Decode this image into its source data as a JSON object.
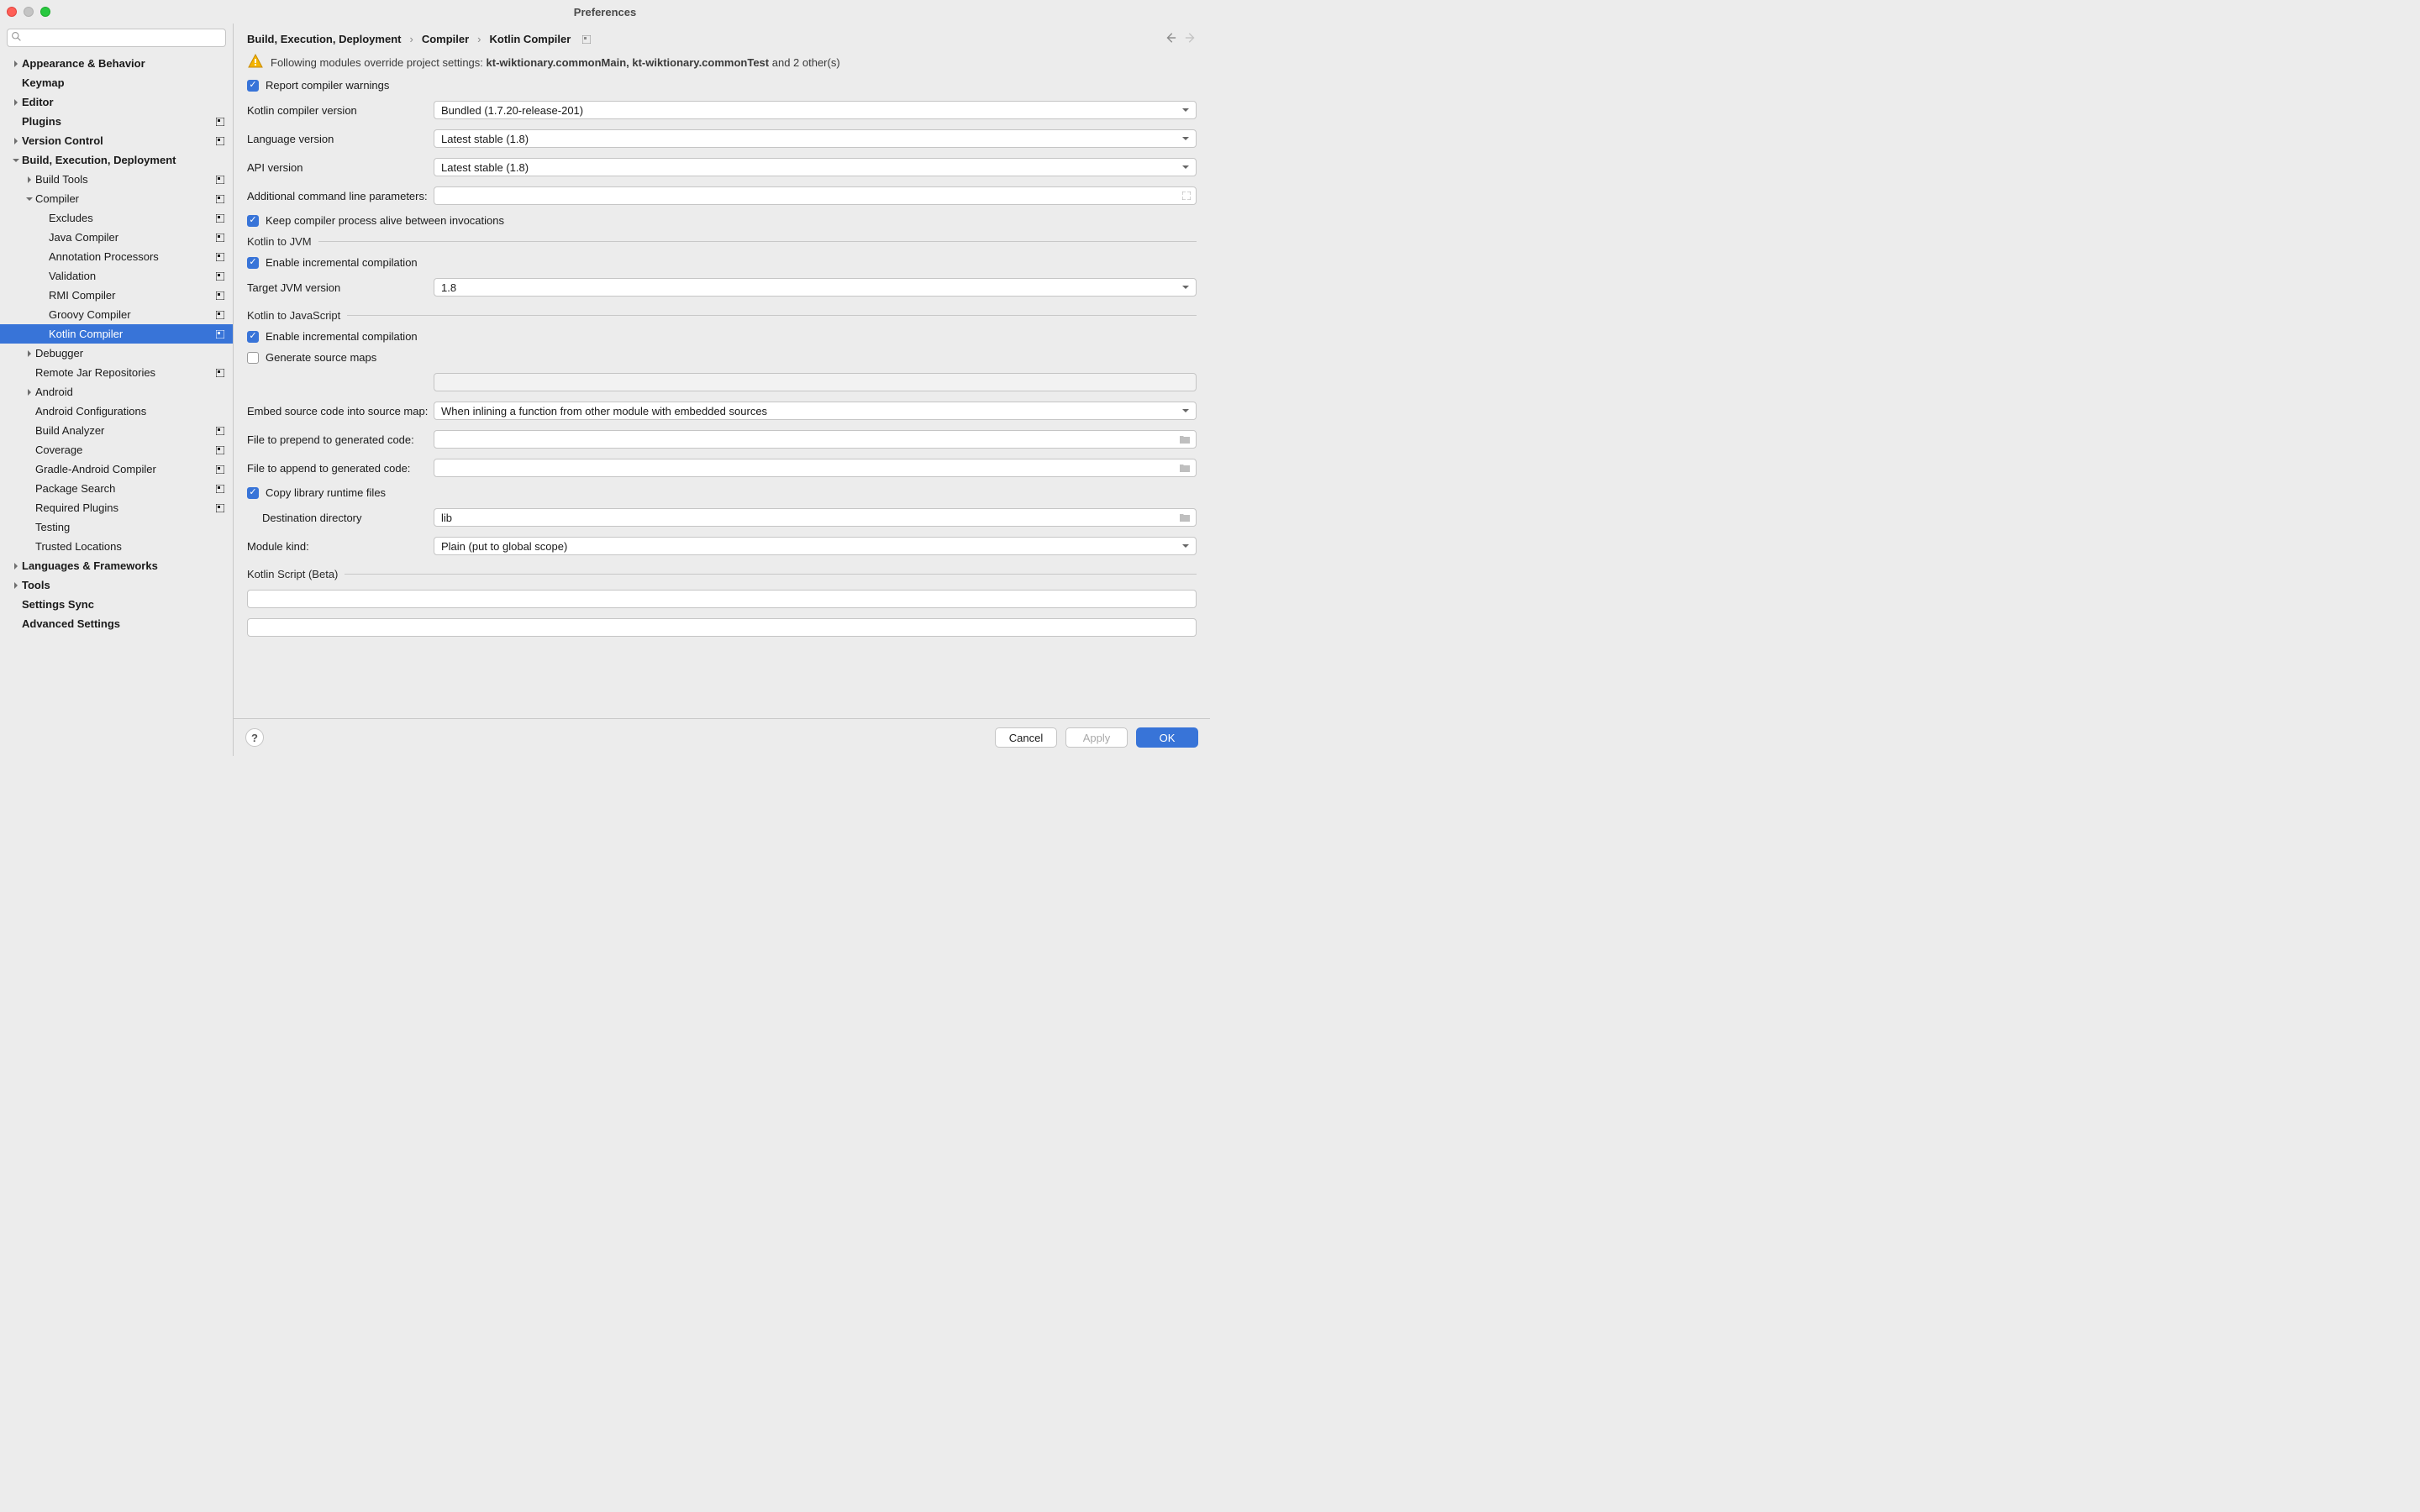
{
  "title": "Preferences",
  "search_placeholder": "",
  "sidebar": {
    "items": [
      {
        "label": "Appearance & Behavior",
        "indent": 0,
        "arrow": "right",
        "bold": true,
        "proj": false
      },
      {
        "label": "Keymap",
        "indent": 0,
        "arrow": "",
        "bold": true,
        "proj": false
      },
      {
        "label": "Editor",
        "indent": 0,
        "arrow": "right",
        "bold": true,
        "proj": false
      },
      {
        "label": "Plugins",
        "indent": 0,
        "arrow": "",
        "bold": true,
        "proj": true
      },
      {
        "label": "Version Control",
        "indent": 0,
        "arrow": "right",
        "bold": true,
        "proj": true
      },
      {
        "label": "Build, Execution, Deployment",
        "indent": 0,
        "arrow": "down",
        "bold": true,
        "proj": false
      },
      {
        "label": "Build Tools",
        "indent": 1,
        "arrow": "right",
        "bold": false,
        "proj": true
      },
      {
        "label": "Compiler",
        "indent": 1,
        "arrow": "down",
        "bold": false,
        "proj": true
      },
      {
        "label": "Excludes",
        "indent": 2,
        "arrow": "",
        "bold": false,
        "proj": true
      },
      {
        "label": "Java Compiler",
        "indent": 2,
        "arrow": "",
        "bold": false,
        "proj": true
      },
      {
        "label": "Annotation Processors",
        "indent": 2,
        "arrow": "",
        "bold": false,
        "proj": true
      },
      {
        "label": "Validation",
        "indent": 2,
        "arrow": "",
        "bold": false,
        "proj": true
      },
      {
        "label": "RMI Compiler",
        "indent": 2,
        "arrow": "",
        "bold": false,
        "proj": true
      },
      {
        "label": "Groovy Compiler",
        "indent": 2,
        "arrow": "",
        "bold": false,
        "proj": true
      },
      {
        "label": "Kotlin Compiler",
        "indent": 2,
        "arrow": "",
        "bold": false,
        "proj": true,
        "selected": true
      },
      {
        "label": "Debugger",
        "indent": 1,
        "arrow": "right",
        "bold": false,
        "proj": false
      },
      {
        "label": "Remote Jar Repositories",
        "indent": 1,
        "arrow": "",
        "bold": false,
        "proj": true
      },
      {
        "label": "Android",
        "indent": 1,
        "arrow": "right",
        "bold": false,
        "proj": false
      },
      {
        "label": "Android Configurations",
        "indent": 1,
        "arrow": "",
        "bold": false,
        "proj": false
      },
      {
        "label": "Build Analyzer",
        "indent": 1,
        "arrow": "",
        "bold": false,
        "proj": true
      },
      {
        "label": "Coverage",
        "indent": 1,
        "arrow": "",
        "bold": false,
        "proj": true
      },
      {
        "label": "Gradle-Android Compiler",
        "indent": 1,
        "arrow": "",
        "bold": false,
        "proj": true
      },
      {
        "label": "Package Search",
        "indent": 1,
        "arrow": "",
        "bold": false,
        "proj": true
      },
      {
        "label": "Required Plugins",
        "indent": 1,
        "arrow": "",
        "bold": false,
        "proj": true
      },
      {
        "label": "Testing",
        "indent": 1,
        "arrow": "",
        "bold": false,
        "proj": false
      },
      {
        "label": "Trusted Locations",
        "indent": 1,
        "arrow": "",
        "bold": false,
        "proj": false
      },
      {
        "label": "Languages & Frameworks",
        "indent": 0,
        "arrow": "right",
        "bold": true,
        "proj": false
      },
      {
        "label": "Tools",
        "indent": 0,
        "arrow": "right",
        "bold": true,
        "proj": false
      },
      {
        "label": "Settings Sync",
        "indent": 0,
        "arrow": "",
        "bold": true,
        "proj": false
      },
      {
        "label": "Advanced Settings",
        "indent": 0,
        "arrow": "",
        "bold": true,
        "proj": false
      }
    ]
  },
  "breadcrumb": {
    "items": [
      "Build, Execution, Deployment",
      "Compiler",
      "Kotlin Compiler"
    ]
  },
  "warning": {
    "prefix": "Following modules override project settings: ",
    "modules": "kt-wiktionary.commonMain, kt-wiktionary.commonTest",
    "suffix": " and 2 other(s)"
  },
  "form": {
    "report_warnings": "Report compiler warnings",
    "compiler_version_label": "Kotlin compiler version",
    "compiler_version_value": "Bundled (1.7.20-release-201)",
    "language_version_label": "Language version",
    "language_version_value": "Latest stable (1.8)",
    "api_version_label": "API version",
    "api_version_value": "Latest stable (1.8)",
    "additional_params_label": "Additional command line parameters:",
    "additional_params_value": "",
    "keep_alive": "Keep compiler process alive between invocations",
    "jvm_section": "Kotlin to JVM",
    "jvm_incremental": "Enable incremental compilation",
    "target_jvm_label": "Target JVM version",
    "target_jvm_value": "1.8",
    "js_section": "Kotlin to JavaScript",
    "js_incremental": "Enable incremental compilation",
    "js_sourcemaps": "Generate source maps",
    "embed_label": "Embed source code into source map:",
    "embed_value": "When inlining a function from other module with embedded sources",
    "prepend_label": "File to prepend to generated code:",
    "prepend_value": "",
    "append_label": "File to append to generated code:",
    "append_value": "",
    "copy_runtime": "Copy library runtime files",
    "dest_dir_label": "Destination directory",
    "dest_dir_value": "lib",
    "module_kind_label": "Module kind:",
    "module_kind_value": "Plain (put to global scope)",
    "script_section": "Kotlin Script (Beta)"
  },
  "buttons": {
    "cancel": "Cancel",
    "apply": "Apply",
    "ok": "OK"
  }
}
